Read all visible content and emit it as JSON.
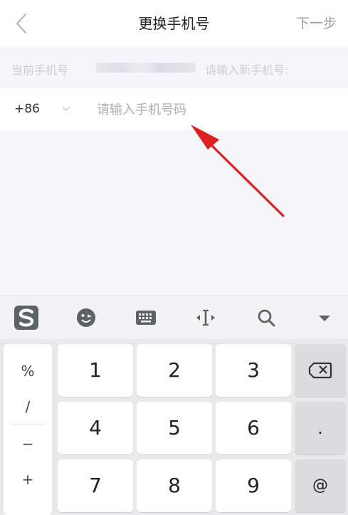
{
  "header": {
    "title": "更换手机号",
    "next_label": "下一步",
    "back_icon": "chevron-left-icon"
  },
  "info": {
    "current_label": "当前手机号",
    "hint": "请输入新手机号:"
  },
  "phone_input": {
    "country_code": "+86",
    "placeholder": "请输入手机号码",
    "value": ""
  },
  "toolbar": {
    "items": [
      "sogou-logo-icon",
      "emoji-icon",
      "keyboard-icon",
      "cursor-move-icon",
      "search-icon",
      "collapse-keyboard-icon"
    ]
  },
  "keyboard": {
    "symbols": [
      "%",
      "/",
      "−",
      "+"
    ],
    "rows": [
      [
        "1",
        "2",
        "3"
      ],
      [
        "4",
        "5",
        "6"
      ],
      [
        "7",
        "8",
        "9"
      ]
    ],
    "side_keys": [
      "backspace-icon",
      ".",
      "@"
    ]
  },
  "colors": {
    "annotation_arrow": "#e02020",
    "background_tint": "#f6f5fa"
  }
}
